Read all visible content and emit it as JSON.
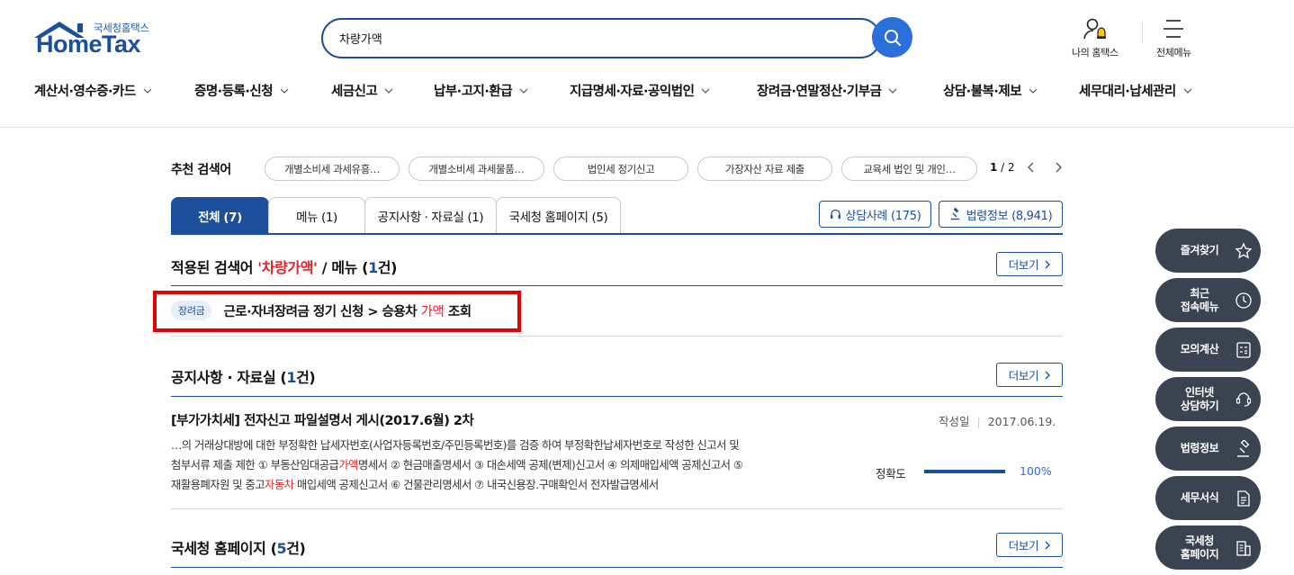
{
  "header": {
    "logo_sub": "국세청홈택스",
    "logo_main": "HomeTax",
    "search_value": "차량가액",
    "my_hometax": "나의 홈택스",
    "all_menu": "전체메뉴"
  },
  "gnb": [
    "계산서·영수증·카드",
    "증명·등록·신청",
    "세금신고",
    "납부·고지·환급",
    "지급명세·자료·공익법인",
    "장려금·연말정산·기부금",
    "상담·불복·제보",
    "세무대리·납세관리"
  ],
  "recommend": {
    "title": "추천 검색어",
    "chips": [
      "개별소비세 과세유흥…",
      "개별소비세 과세물품…",
      "법인세 정기신고",
      "가장자산 자료 제출",
      "교육세 법인 및 개인…"
    ],
    "page_current": "1",
    "page_sep": " / ",
    "page_total": "2"
  },
  "tabs": [
    "전체 (7)",
    "메뉴 (1)",
    "공지사항 · 자료실 (1)",
    "국세청 홈페이지 (5)"
  ],
  "side_buttons": {
    "counsel": "상담사례 (175)",
    "law": "법령정보 (8,941)"
  },
  "menu_section": {
    "prefix": "적용된 검색어 ",
    "keyword": "'차량가액'",
    "middle": " / 메뉴 (",
    "count": "1",
    "suffix": "건)",
    "more": "더보기",
    "result_badge": "장려금",
    "result_path_pre": "근로·자녀장려금 정기 신청 > 승용차 ",
    "result_path_hl": "가액",
    "result_path_post": " 조회"
  },
  "notice_section": {
    "title_pre": "공지사항 · 자료실 (",
    "count": "1",
    "title_post": "건)",
    "more": "더보기",
    "item_title": "[부가가치세] 전자신고 파일설명서 게시(2017.6월) 2차",
    "meta_label": "작성일",
    "meta_date": "2017.06.19.",
    "body_1": "…의 거래상대방에 대한 부정확한 납세자번호(사업자등록번호/주민등록번호)를 검증 하여 부정확한납세자번호로 작성한 신고서 및",
    "body_2a": "첨부서류 제출 제한 ① 부동산임대공급",
    "body_2b": "가액",
    "body_2c": "명세서 ② 현금매출명세서 ③ 대손세액 공제(변제)신고서 ④ 의제매입세액 공제신고서 ⑤",
    "body_3a": "재활용폐자원 및 중고",
    "body_3b": "자동차",
    "body_3c": " 매입세액 공제신고서 ⑥ 건물관리명세서 ⑦ 내국신용장.구매확인서 전자발급명세서",
    "accuracy_label": "정확도",
    "accuracy_value": "100%",
    "accuracy_fraction": 1.0
  },
  "homepage_section": {
    "title_pre": "국세청 홈페이지 (",
    "count": "5",
    "title_post": "건)",
    "more": "더보기"
  },
  "quick_menu": [
    {
      "label": "즐겨찾기",
      "icon": "star-icon"
    },
    {
      "label": "최근\n접속메뉴",
      "icon": "clock-icon"
    },
    {
      "label": "모의계산",
      "icon": "calculator-icon"
    },
    {
      "label": "인터넷\n상담하기",
      "icon": "chat-icon"
    },
    {
      "label": "법령정보",
      "icon": "gavel-icon"
    },
    {
      "label": "세무서식",
      "icon": "document-icon"
    },
    {
      "label": "국세청\n홈페이지",
      "icon": "building-icon"
    }
  ],
  "colors": {
    "brand": "#1b4f9c",
    "accent": "#2a6fdc",
    "keyword": "#e4242b",
    "highlight_box": "#e60000",
    "quick_bg": "#3a4350"
  }
}
